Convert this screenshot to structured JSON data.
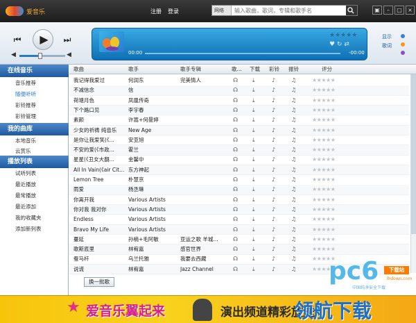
{
  "titlebar": {
    "app_title": "爱音乐",
    "register": "注册",
    "login": "登录",
    "search_scope": "网络",
    "search_placeholder": "输入歌曲，歌词，专辑和歌手名"
  },
  "player": {
    "time_current": "00:00",
    "time_total": "-00:00",
    "volume_level": 0.45,
    "progress": 0,
    "show_label": "显示",
    "lyrics_label": "歌词"
  },
  "sidebar": {
    "sections": [
      {
        "title": "在线音乐",
        "items": [
          "音乐推荐",
          "随便听听",
          "彩铃推荐",
          "彩铃管理"
        ],
        "active_index": 1
      },
      {
        "title": "我的曲库",
        "items": [
          "本地音乐",
          "云赏乐"
        ]
      },
      {
        "title": "播放列表",
        "items": [
          "试听列表",
          "最近播放",
          "最常播放",
          "最近添加",
          "我的收藏夹",
          "添加新列表"
        ]
      }
    ]
  },
  "table": {
    "columns": [
      "歌曲",
      "歌手",
      "歌手专辑",
      "歌...",
      "下载",
      "彩铃",
      "振铃",
      "评分"
    ],
    "rows": [
      [
        "我记得我爱过",
        "何润东",
        "完美情人"
      ],
      [
        "不减信念",
        "信",
        ""
      ],
      [
        "荷塘月色",
        "凤凰传奇",
        ""
      ],
      [
        "下个路口见",
        "李宇春",
        ""
      ],
      [
        "素颜",
        "许嵩+何曼婷",
        ""
      ],
      [
        "少女的祈祷 纯音乐",
        "New Age",
        ""
      ],
      [
        "是你让我爱笑(《...",
        "安亚旭",
        ""
      ],
      [
        "不安的爱(《市政...",
        "霍兰",
        ""
      ],
      [
        "星星(《丑女大翻...",
        "金馨中",
        ""
      ],
      [
        "All In Vain(《air Cit...",
        "东方神起",
        ""
      ],
      [
        "Lemon Tree",
        "朴慧京",
        ""
      ],
      [
        "雨爱",
        "杨丞琳",
        ""
      ],
      [
        "你离开我",
        "Various Artists",
        ""
      ],
      [
        "你对我 我对你",
        "Various Artists",
        ""
      ],
      [
        "Endless",
        "Various Artists",
        ""
      ],
      [
        "Bravo My Life",
        "Various Artists",
        ""
      ],
      [
        "蔓延",
        "孙楠+毛阿敏",
        "亚运之歌 羊城..."
      ],
      [
        "歌斯底里",
        "林宥嘉",
        "感官世界"
      ],
      [
        "蚕马杆",
        "乌兰托雅",
        "我要去西藏"
      ],
      [
        "说谎",
        "林宥嘉",
        "Jazz Channel"
      ]
    ],
    "batch_button": "换一批歌"
  },
  "watermark": {
    "brand": "pc6",
    "download_tag": "下载站",
    "subtitle": "中国纯净安全下载",
    "site": ".lhdown.com"
  },
  "banner": {
    "left_text": "爱音乐翼起来",
    "right_text": "演出频道精彩放送",
    "brand_text": "领航下载"
  },
  "colors": {
    "accent_blue": "#1d5aa0",
    "lcd_blue": "#1a8ad0",
    "banner_yellow": "#f9d21d",
    "dot_blue": "#3b7fd6",
    "dot_orange": "#f39a1d",
    "dot_purple": "#8a4fc4"
  },
  "icons": {
    "prev": "prev-track-icon",
    "play": "play-icon",
    "next": "next-track-icon",
    "volume": "speaker-icon",
    "headphones": "headphones-icon",
    "download": "download-icon",
    "ringtone": "music-note-icon",
    "rating": "star-icon"
  }
}
